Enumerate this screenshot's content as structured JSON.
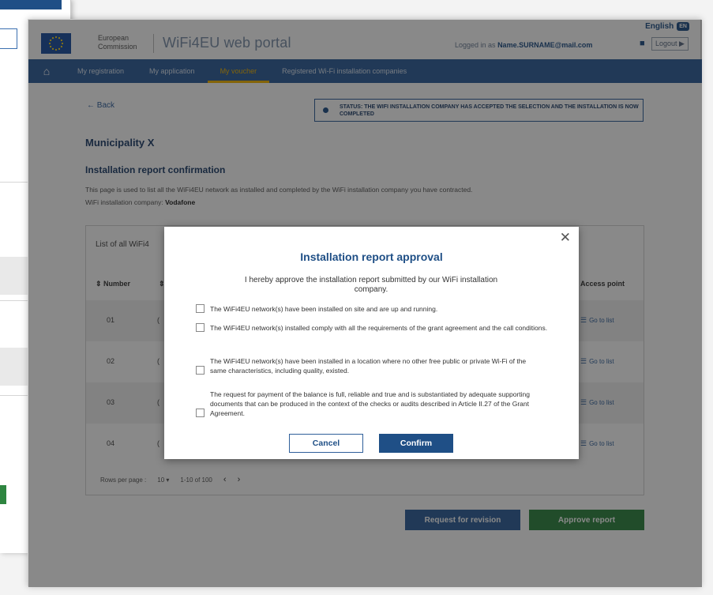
{
  "header": {
    "language": "English",
    "language_code": "EN",
    "commission_name": "European Commission",
    "portal_title": "WiFi4EU web portal",
    "logged_in_prefix": "Logged in as",
    "user_email": "Name.SURNAME@mail.com",
    "logout_label": "Logout"
  },
  "nav": {
    "tabs": [
      {
        "label": "My registration",
        "active": false
      },
      {
        "label": "My application",
        "active": false
      },
      {
        "label": "My voucher",
        "active": true
      },
      {
        "label": "Registered Wi-Fi installation companies",
        "active": false
      }
    ],
    "active_color": "#f3b400"
  },
  "page": {
    "back_label": "← Back",
    "status_text": "STATUS: THE WIFI INSTALLATION COMPANY HAS ACCEPTED THE SELECTION AND THE INSTALLATION IS NOW COMPLETED",
    "municipality": "Municipality X",
    "report_title": "Installation report confirmation",
    "description": "This page is used to list all the WiFi4EU network as installed and completed by the WiFi installation company you have contracted.",
    "company_prefix": "WiFi installation company:",
    "company_name": "Vodafone"
  },
  "table": {
    "title": "List of all WiFi4",
    "headers": {
      "number": "⇕ Number",
      "second": "⇕",
      "access_point": "Access point"
    },
    "rows": [
      {
        "number": "01",
        "col2": "(",
        "action": "Go to list"
      },
      {
        "number": "02",
        "col2": "(",
        "action": "Go to list"
      },
      {
        "number": "03",
        "col2": "(",
        "action": "Go to list"
      },
      {
        "number": "04",
        "col2": "(",
        "action": "Go to list"
      }
    ],
    "pager": {
      "rows_per_page_label": "Rows per page :",
      "rows_per_page_value": "10 ▾",
      "range": "1-10 of 100",
      "prev": "‹",
      "next": "›"
    }
  },
  "actions": {
    "revision_label": "Request for revision",
    "approve_label": "Approve report"
  },
  "modal": {
    "close": "✕",
    "title": "Installation report approval",
    "intro": "I hereby approve the installation report submitted by our WiFi installation company.",
    "checks": [
      "The WiFi4EU network(s) have been installed on site and are up and running.",
      "The WiFi4EU network(s) installed comply with all the requirements of the grant agreement and the call conditions.",
      "The WiFi4EU network(s) have been installed in a location where no other free public or private Wi-Fi of the same characteristics, including quality, existed.",
      "The request for payment of the balance is full, reliable and true and is substantiated by adequate supporting documents that can be produced in the context of the checks or audits described in Article II.27 of the Grant Agreement."
    ],
    "cancel_label": "Cancel",
    "confirm_label": "Confirm"
  },
  "colors": {
    "primary": "#1f4f86",
    "nav": "#2f5f9a",
    "approve": "#2e8540"
  }
}
